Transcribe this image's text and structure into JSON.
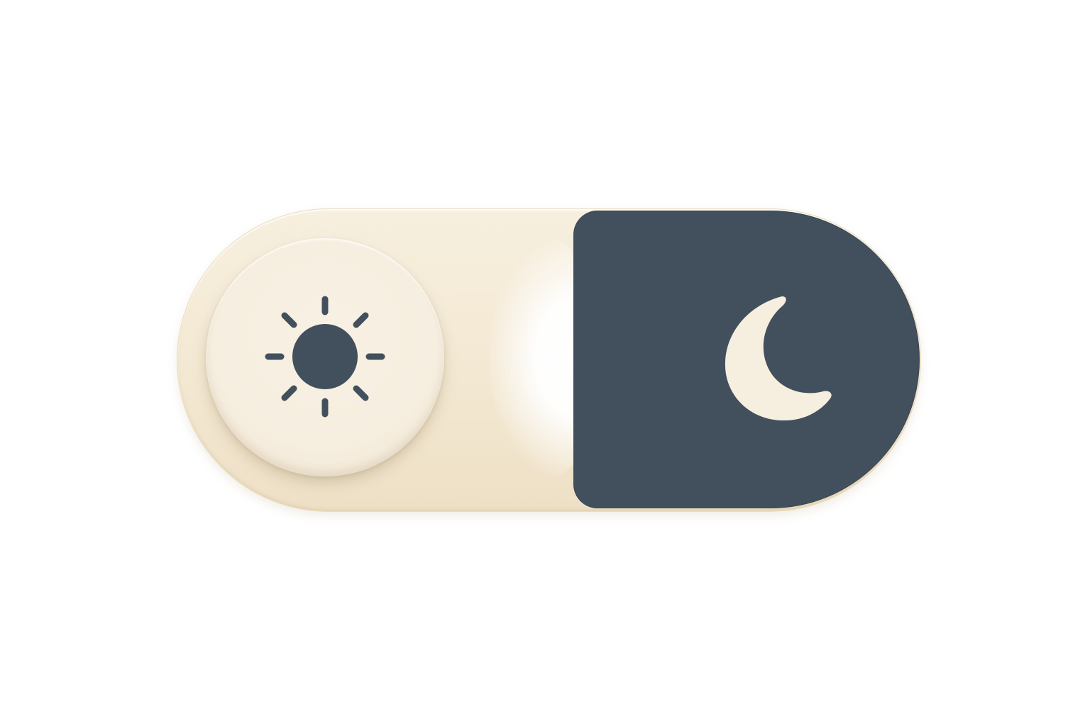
{
  "theme_toggle": {
    "state": "light",
    "left_icon": "sun-icon",
    "right_icon": "moon-icon",
    "colors": {
      "track": "#f3e8d2",
      "knob": "#f6eedf",
      "night_panel": "#42505d",
      "icon_dark": "#42505d",
      "icon_light": "#f6eedf"
    }
  }
}
